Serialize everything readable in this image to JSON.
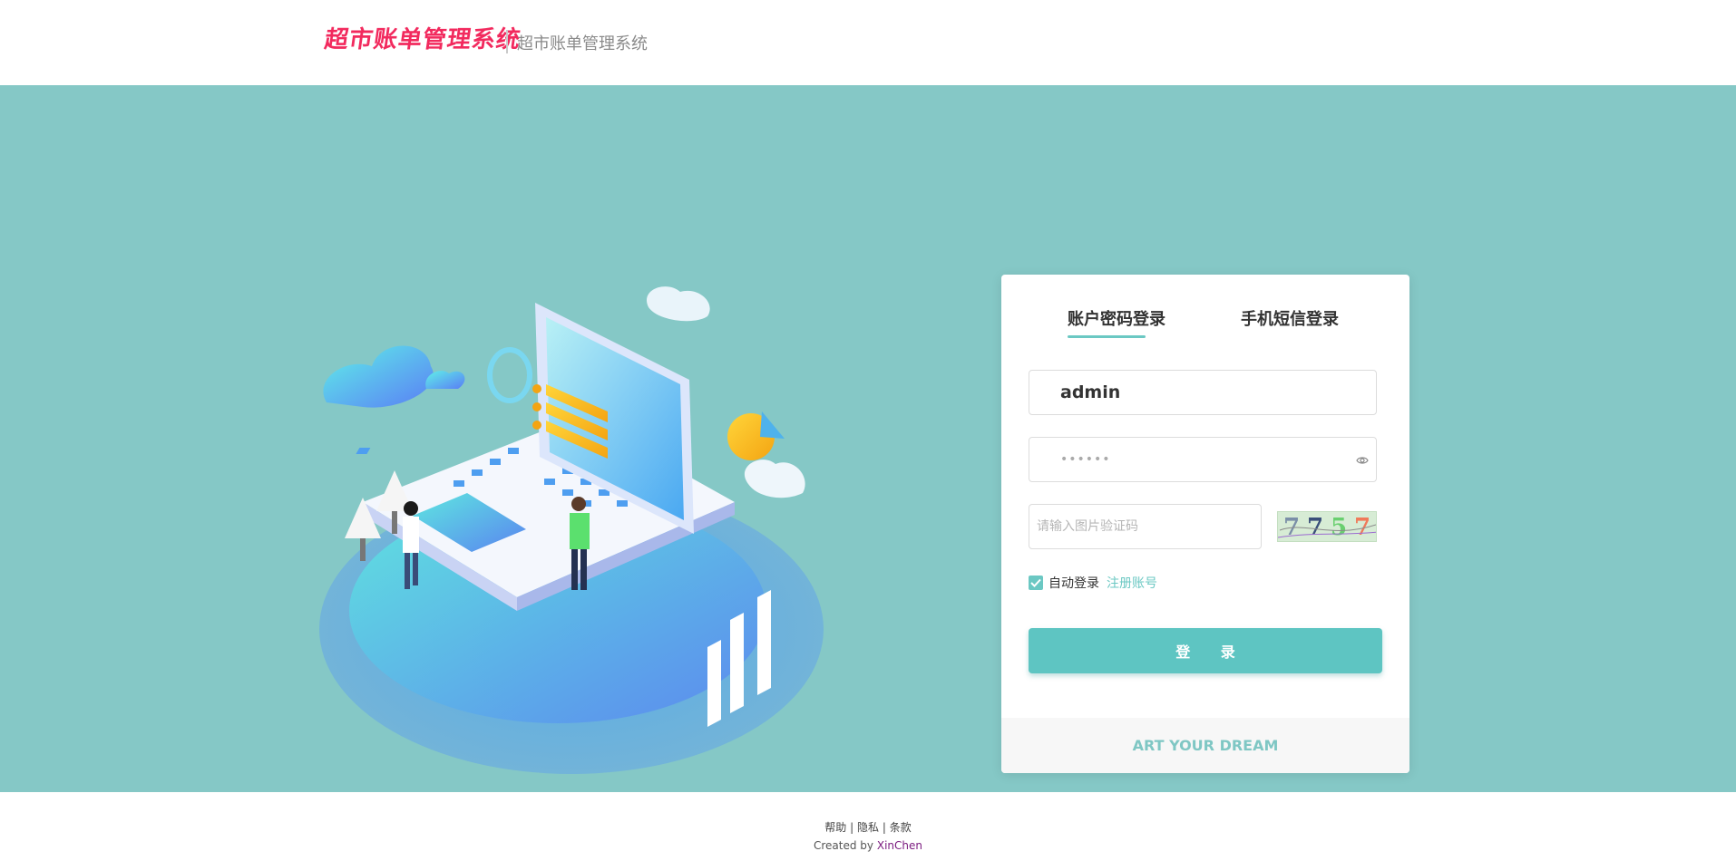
{
  "header": {
    "logo_art_text": "超市账单管理系统",
    "logo_text": "超市账单管理系统"
  },
  "login": {
    "tabs": [
      {
        "label": "账户密码登录",
        "active": true
      },
      {
        "label": "手机短信登录",
        "active": false
      }
    ],
    "username_value": "admin",
    "password_value": "••••••",
    "captcha_placeholder": "请输入图片验证码",
    "captcha_chars": [
      "7",
      "7",
      "5",
      "7"
    ],
    "remember_label": "自动登录",
    "remember_checked": true,
    "register_link": "注册账号",
    "login_button": "登 录",
    "footer_text": "ART YOUR DREAM"
  },
  "footer": {
    "links": [
      "帮助",
      "隐私",
      "条款"
    ],
    "credit_prefix": "Created by",
    "credit_author": "XinChen"
  },
  "colors": {
    "background": "#85c8c6",
    "accent": "#6bc8c3",
    "logo": "#f22a5e",
    "author": "#7c1d80"
  },
  "icons": [
    "eye-icon",
    "check-icon"
  ]
}
